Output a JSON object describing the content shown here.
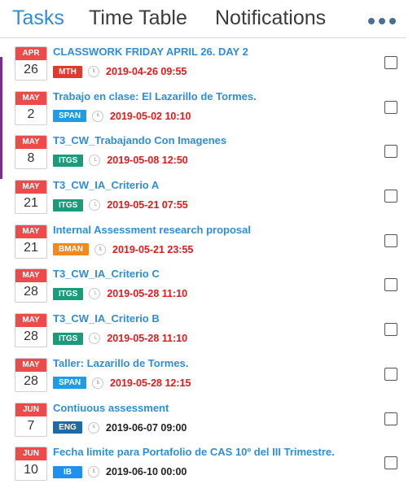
{
  "tabs": {
    "tasks": "Tasks",
    "timetable": "Time Table",
    "notifications": "Notifications"
  },
  "colors": {
    "accent": "#2d8dd9",
    "overdue": "#e21a1a",
    "calendar_header": "#ef4a4a"
  },
  "tasks": [
    {
      "month": "APR",
      "day": "26",
      "title": "CLASSWORK FRIDAY APRIL 26. DAY 2",
      "subject": "MTH",
      "subject_color": "#e03a2f",
      "due": "2019-04-26 09:55",
      "due_status": "overdue"
    },
    {
      "month": "MAY",
      "day": "2",
      "title": "Trabajo en clase: El Lazarillo de Tormes.",
      "subject": "SPAN",
      "subject_color": "#1e9de6",
      "due": "2019-05-02 10:10",
      "due_status": "overdue"
    },
    {
      "month": "MAY",
      "day": "8",
      "title": "T3_CW_Trabajando Con Imagenes",
      "subject": "ITGS",
      "subject_color": "#1a9b79",
      "due": "2019-05-08 12:50",
      "due_status": "overdue"
    },
    {
      "month": "MAY",
      "day": "21",
      "title": "T3_CW_IA_Criterio A",
      "subject": "ITGS",
      "subject_color": "#1a9b79",
      "due": "2019-05-21 07:55",
      "due_status": "overdue"
    },
    {
      "month": "MAY",
      "day": "21",
      "title": "Internal Assessment research proposal",
      "subject": "BMAN",
      "subject_color": "#f2891f",
      "due": "2019-05-21 23:55",
      "due_status": "overdue"
    },
    {
      "month": "MAY",
      "day": "28",
      "title": "T3_CW_IA_Criterio C",
      "subject": "ITGS",
      "subject_color": "#1a9b79",
      "due": "2019-05-28 11:10",
      "due_status": "overdue"
    },
    {
      "month": "MAY",
      "day": "28",
      "title": "T3_CW_IA_Criterio B",
      "subject": "ITGS",
      "subject_color": "#1a9b79",
      "due": "2019-05-28 11:10",
      "due_status": "overdue"
    },
    {
      "month": "MAY",
      "day": "28",
      "title": "Taller: Lazarillo de Tormes.",
      "subject": "SPAN",
      "subject_color": "#1e9de6",
      "due": "2019-05-28 12:15",
      "due_status": "overdue"
    },
    {
      "month": "JUN",
      "day": "7",
      "title": "Contiuous assessment",
      "subject": "ENG",
      "subject_color": "#1d6aa8",
      "due": "2019-06-07 09:00",
      "due_status": "ok"
    },
    {
      "month": "JUN",
      "day": "10",
      "title": "Fecha limite para Portafolio de CAS 10º del III Trimestre.",
      "subject": "IB",
      "subject_color": "#1f8ff0",
      "due": "2019-06-10 00:00",
      "due_status": "ok"
    }
  ]
}
